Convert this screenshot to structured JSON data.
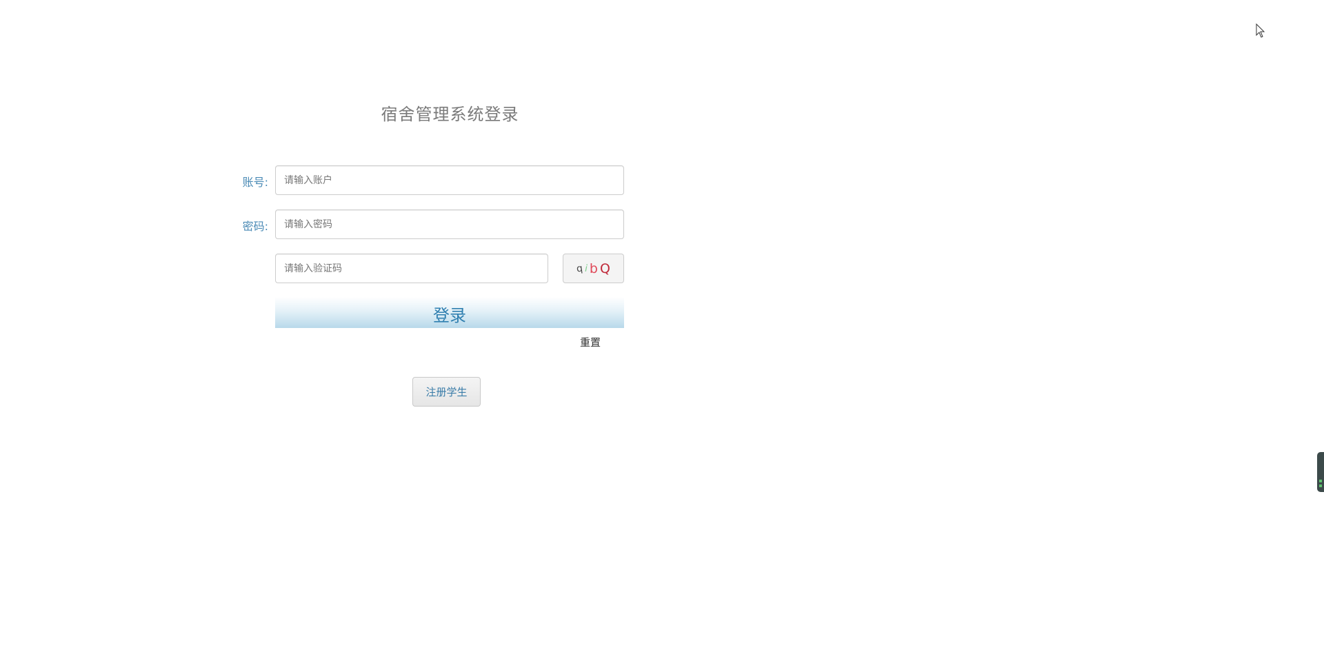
{
  "login": {
    "title": "宿舍管理系统登录",
    "account_label": "账号:",
    "account_placeholder": "请输入账户",
    "password_label": "密码:",
    "password_placeholder": "请输入密码",
    "captcha_placeholder": "请输入验证码",
    "captcha_chars": [
      "q",
      "i",
      "b",
      "Q"
    ],
    "login_label": "登录",
    "reset_label": "重置",
    "register_label": "注册学生"
  },
  "colors": {
    "label": "#4a8ab5",
    "title": "#7a7a7a",
    "login_text": "#2f7fb0"
  },
  "icons": {
    "cursor": "mouse-pointer-icon",
    "side_widget": "side-panel-handle"
  }
}
